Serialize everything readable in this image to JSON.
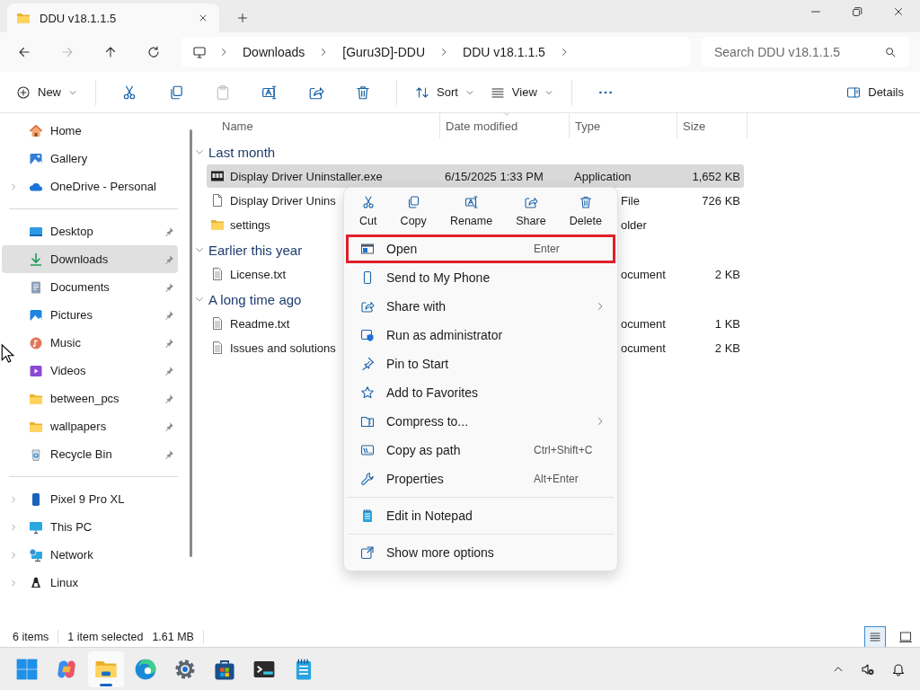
{
  "window": {
    "tab_title": "DDU v18.1.1.5"
  },
  "nav_buttons": [
    {
      "disabled": false
    },
    {
      "disabled": true
    },
    {
      "disabled": false
    },
    {
      "disabled": false
    }
  ],
  "breadcrumbs": [
    "Downloads",
    "[Guru3D]-DDU",
    "DDU v18.1.1.5"
  ],
  "search": {
    "placeholder": "Search DDU v18.1.1.5"
  },
  "toolbar": {
    "new": "New",
    "actions": [
      {
        "disabled": false
      },
      {
        "disabled": false
      },
      {
        "disabled": true
      },
      {
        "disabled": false
      },
      {
        "disabled": false
      },
      {
        "disabled": false
      }
    ],
    "sort": "Sort",
    "view": "View",
    "details": "Details"
  },
  "sidebar": {
    "sections": [
      [
        {
          "label": "Home",
          "expandable": false,
          "pinned": false,
          "selected": false
        },
        {
          "label": "Gallery",
          "expandable": false,
          "pinned": false,
          "selected": false
        },
        {
          "label": "OneDrive - Personal",
          "expandable": true,
          "pinned": false,
          "selected": false
        }
      ],
      [
        {
          "label": "Desktop",
          "expandable": false,
          "pinned": true,
          "selected": false
        },
        {
          "label": "Downloads",
          "expandable": false,
          "pinned": true,
          "selected": true
        },
        {
          "label": "Documents",
          "expandable": false,
          "pinned": true,
          "selected": false
        },
        {
          "label": "Pictures",
          "expandable": false,
          "pinned": true,
          "selected": false
        },
        {
          "label": "Music",
          "expandable": false,
          "pinned": true,
          "selected": false
        },
        {
          "label": "Videos",
          "expandable": false,
          "pinned": true,
          "selected": false
        },
        {
          "label": "between_pcs",
          "expandable": false,
          "pinned": true,
          "selected": false
        },
        {
          "label": "wallpapers",
          "expandable": false,
          "pinned": true,
          "selected": false
        },
        {
          "label": "Recycle Bin",
          "expandable": false,
          "pinned": true,
          "selected": false
        }
      ],
      [
        {
          "label": "Pixel 9 Pro XL",
          "expandable": true,
          "pinned": false,
          "selected": false
        },
        {
          "label": "This PC",
          "expandable": true,
          "pinned": false,
          "selected": false
        },
        {
          "label": "Network",
          "expandable": true,
          "pinned": false,
          "selected": false
        },
        {
          "label": "Linux",
          "expandable": true,
          "pinned": false,
          "selected": false
        }
      ]
    ]
  },
  "columns": [
    "Name",
    "Date modified",
    "Type",
    "Size"
  ],
  "groups": [
    {
      "title": "Last month",
      "expanded": true,
      "rows": [
        {
          "kind": "app",
          "name": "Display Driver Uninstaller.exe",
          "date": "6/15/2025 1:33 PM",
          "type": "Application",
          "size": "1,652 KB",
          "selected": true
        },
        {
          "kind": "file",
          "name": "Display Driver Unins",
          "type": "File",
          "size": "726 KB",
          "selected": false
        },
        {
          "kind": "folder",
          "name": "settings",
          "type": "older",
          "selected": false
        }
      ]
    },
    {
      "title": "Earlier this year",
      "expanded": true,
      "rows": [
        {
          "kind": "text",
          "name": "License.txt",
          "type": "ocument",
          "size": "2 KB",
          "selected": false
        }
      ]
    },
    {
      "title": "A long time ago",
      "expanded": true,
      "rows": [
        {
          "kind": "text",
          "name": "Readme.txt",
          "type": "ocument",
          "size": "1 KB",
          "selected": false
        },
        {
          "kind": "text",
          "name": "Issues and solutions",
          "type": "ocument",
          "size": "2 KB",
          "selected": false
        }
      ]
    }
  ],
  "context_menu": {
    "quick_actions": [
      "Cut",
      "Copy",
      "Rename",
      "Share",
      "Delete"
    ],
    "sections": [
      [
        {
          "label": "Open",
          "shortcut": "Enter",
          "submenu": false,
          "highlighted": true
        },
        {
          "label": "Send to My Phone",
          "submenu": false,
          "highlighted": false
        },
        {
          "label": "Share with",
          "submenu": true,
          "highlighted": false
        },
        {
          "label": "Run as administrator",
          "submenu": false,
          "highlighted": false
        },
        {
          "label": "Pin to Start",
          "submenu": false,
          "highlighted": false
        },
        {
          "label": "Add to Favorites",
          "submenu": false,
          "highlighted": false
        },
        {
          "label": "Compress to...",
          "submenu": true,
          "highlighted": false
        },
        {
          "label": "Copy as path",
          "shortcut": "Ctrl+Shift+C",
          "submenu": false,
          "highlighted": false
        },
        {
          "label": "Properties",
          "shortcut": "Alt+Enter",
          "submenu": false,
          "highlighted": false
        }
      ],
      [
        {
          "label": "Edit in Notepad",
          "submenu": false,
          "highlighted": false
        }
      ],
      [
        {
          "label": "Show more options",
          "submenu": false,
          "highlighted": false
        }
      ]
    ]
  },
  "status_bar": {
    "items": "6 items",
    "selection": "1 item selected",
    "size": "1.61 MB"
  },
  "view_toggle": [
    {
      "selected": true
    },
    {
      "selected": false
    }
  ],
  "taskbar": {
    "apps": [
      {
        "selected": false
      },
      {
        "selected": false
      },
      {
        "selected": true
      },
      {
        "selected": false
      },
      {
        "selected": false
      },
      {
        "selected": false
      },
      {
        "selected": false
      },
      {
        "selected": false
      }
    ]
  }
}
